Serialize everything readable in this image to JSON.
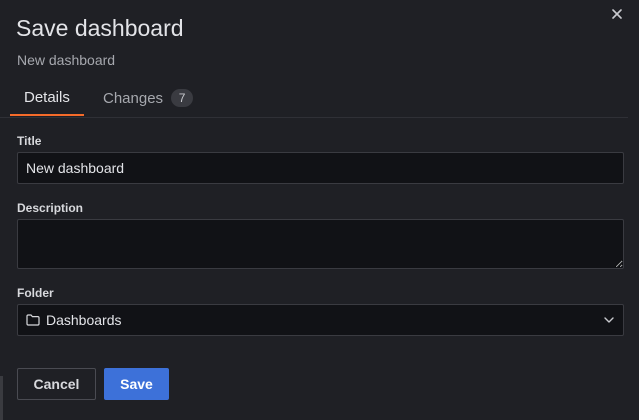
{
  "dialog": {
    "title": "Save dashboard",
    "subtitle": "New dashboard"
  },
  "tabs": [
    {
      "label": "Details",
      "active": true
    },
    {
      "label": "Changes",
      "count": "7",
      "active": false
    }
  ],
  "form": {
    "title_label": "Title",
    "title_value": "New dashboard",
    "description_label": "Description",
    "description_value": "",
    "folder_label": "Folder",
    "folder_value": "Dashboards"
  },
  "actions": {
    "cancel_label": "Cancel",
    "save_label": "Save"
  },
  "icons": {
    "close": "close-icon",
    "folder": "folder-icon",
    "dropdown": "chevron-down-icon"
  },
  "colors": {
    "active_tab_underline": "#f56b2a",
    "primary_button": "#3d71d9",
    "background": "#1f2025"
  }
}
